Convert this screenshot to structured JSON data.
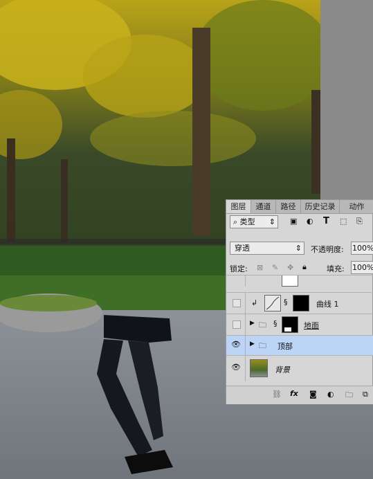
{
  "photo": {
    "description_icon": "park-photo"
  },
  "panel": {
    "tabs": [
      "图层",
      "通道",
      "路径",
      "历史记录",
      "动作"
    ],
    "filter_label": "类型",
    "blend_mode": "穿透",
    "opacity_label": "不透明度:",
    "opacity_value": "100%",
    "lock_label": "锁定:",
    "fill_label": "填充:",
    "fill_value": "100%",
    "layers": [
      {
        "name": "曲线 1"
      },
      {
        "name": "地面"
      },
      {
        "name": "顶部"
      },
      {
        "name": "背景"
      }
    ],
    "bottom_icons": [
      "link-icon",
      "fx-icon",
      "mask-icon",
      "adjustment-icon",
      "folder-icon",
      "new-layer-icon"
    ],
    "fx_label": "fx"
  },
  "colors": {
    "selected_row": "#bcd4f5",
    "panel_bg": "#d6d6d6"
  }
}
